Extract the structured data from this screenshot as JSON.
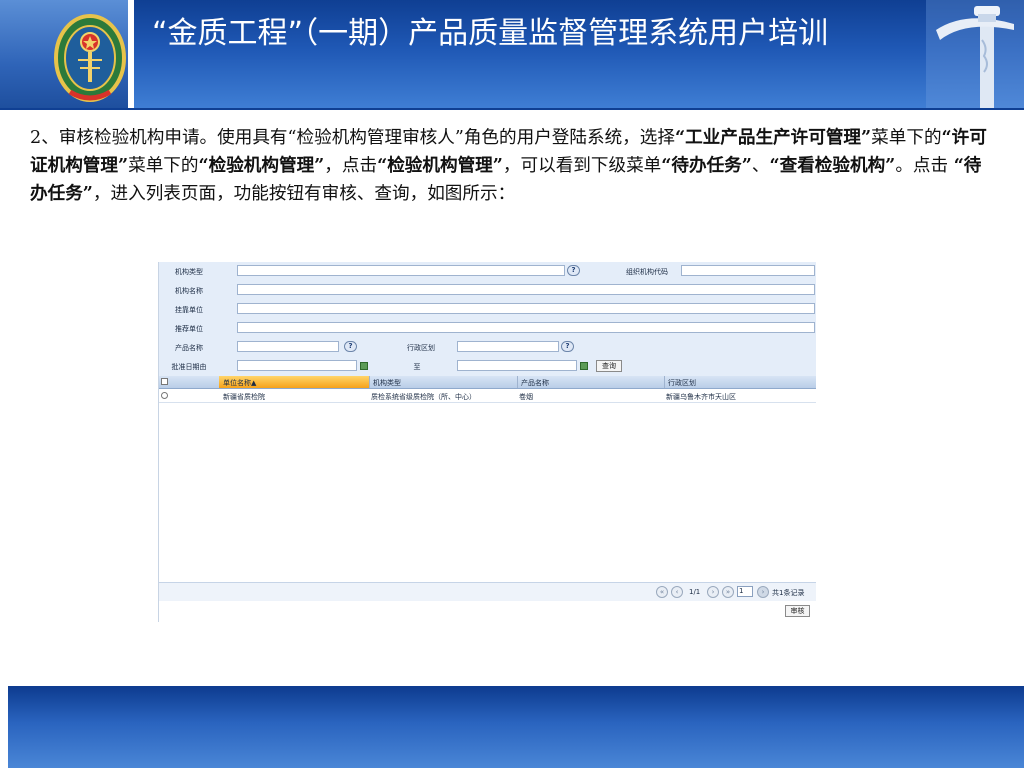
{
  "slide": {
    "title": "“金质工程”（一期）产品质量监督管理系统用户培训",
    "instruction": {
      "p1": "2、审核检验机构申请。使用具有“检验机构管理审核人”角色的用户登陆系统，选择",
      "b1": "“工业产品生产许可管理”",
      "p2": "菜单下的",
      "b2": "“许可证机构管理”",
      "p3": "菜单下的",
      "b3": "“检验机构管理”",
      "p4": "，点击",
      "b4": "“检验机构管理”",
      "p5": "，可以看到下级菜单",
      "b5": "“待办任务”",
      "p6": "、",
      "b6": "“查看检验机构”",
      "p7": "。点击 ",
      "b7": "“待办任务”",
      "p8": "，进入列表页面，功能按钮有审核、查询，如图所示："
    }
  },
  "form": {
    "org_type_label": "机构类型",
    "org_code_label": "组织机构代码",
    "org_name_label": "机构名称",
    "accept_unit_label": "挂靠单位",
    "recommend_unit_label": "推荐单位",
    "product_name_label": "产品名称",
    "region_label": "行政区划",
    "approve_date_label": "批准日期由",
    "date_to_label": "至",
    "query_button": "查询",
    "help_glyph": "?"
  },
  "grid": {
    "columns": [
      "单位名称▲",
      "机构类型",
      "产品名称",
      "行政区划"
    ],
    "rows": [
      [
        "新疆省质检院",
        "质检系统省级质检院（所、中心）",
        "卷烟",
        "新疆乌鲁木齐市天山区"
      ]
    ]
  },
  "pager": {
    "page_info": "1/1",
    "page_input": "1",
    "total": "共1条记录"
  },
  "actions": {
    "audit_button": "审核"
  },
  "colors": {
    "title_bar": "#1f58b5",
    "footer": "#2a64bf",
    "form_row": "#e4edf9",
    "sort_header": "#f6a21a"
  }
}
